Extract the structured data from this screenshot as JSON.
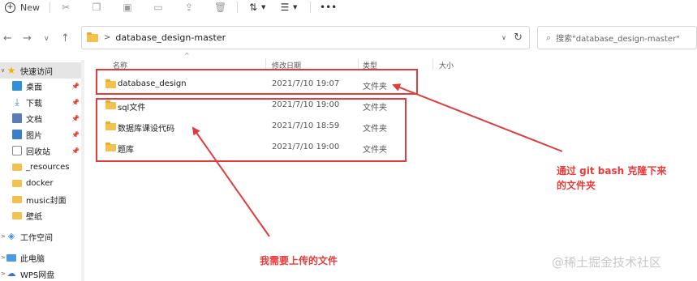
{
  "toolbar": {
    "new_label": "New",
    "icons": [
      "cut-icon",
      "copy-icon",
      "paste-icon",
      "share-icon",
      "delete-icon",
      "sort-icon",
      "view-icon",
      "more-icon"
    ]
  },
  "address": {
    "path": "database_design-master",
    "search_placeholder": "搜索\"database_design-master\""
  },
  "nav": {
    "quick_access": "快速访问",
    "items": [
      {
        "label": "桌面",
        "icon": "desktop-icon",
        "pinned": true
      },
      {
        "label": "下载",
        "icon": "download-icon",
        "pinned": true
      },
      {
        "label": "文档",
        "icon": "documents-icon",
        "pinned": true
      },
      {
        "label": "图片",
        "icon": "pictures-icon",
        "pinned": true
      },
      {
        "label": "回收站",
        "icon": "recycle-bin-icon",
        "pinned": true
      },
      {
        "label": "_resources",
        "icon": "folder-icon",
        "pinned": false
      },
      {
        "label": "docker",
        "icon": "folder-icon",
        "pinned": false
      },
      {
        "label": "music封面",
        "icon": "folder-icon",
        "pinned": false
      },
      {
        "label": "壁纸",
        "icon": "folder-icon",
        "pinned": false
      }
    ],
    "workspace": "工作空间",
    "this_pc": "此电脑",
    "wps": "WPS网盘"
  },
  "columns": {
    "name": "名称",
    "modified": "修改日期",
    "type": "类型",
    "size": "大小"
  },
  "files": [
    {
      "name": "database_design",
      "modified": "2021/7/10 19:07",
      "type": "文件夹"
    },
    {
      "name": "sql文件",
      "modified": "2021/7/10 19:00",
      "type": "文件夹"
    },
    {
      "name": "数据库课设代码",
      "modified": "2021/7/10 18:59",
      "type": "文件夹"
    },
    {
      "name": "题库",
      "modified": "2021/7/10 19:00",
      "type": "文件夹"
    }
  ],
  "annotations": {
    "git_clone_line1": "通过 git bash 克隆下来",
    "git_clone_line2": "的文件夹",
    "upload_note": "我需要上传的文件",
    "color": "#e03c3c"
  },
  "watermark": "@稀土掘金技术社区"
}
